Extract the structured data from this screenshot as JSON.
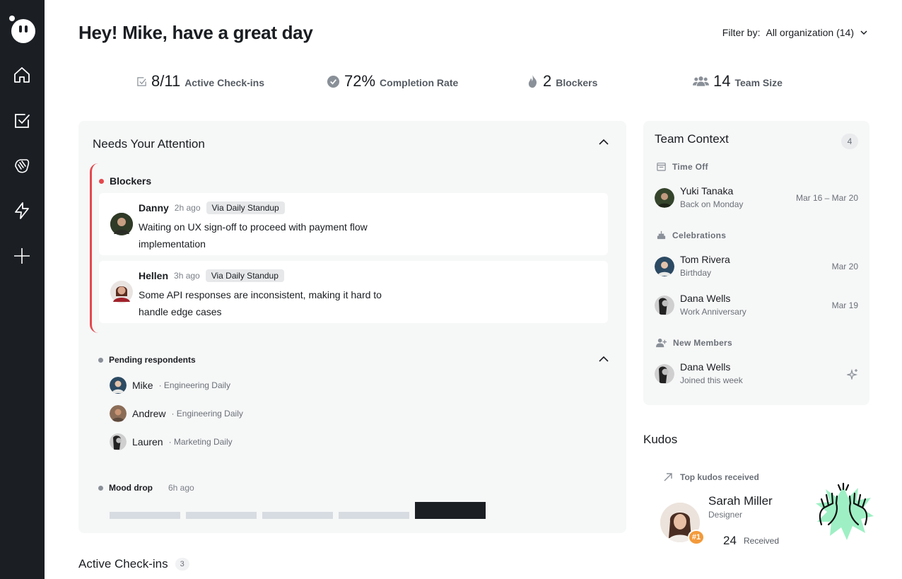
{
  "header": {
    "greeting": "Hey! Mike, have a great day",
    "filter_label": "Filter by:",
    "filter_value": "All organization (14)"
  },
  "stats": [
    {
      "icon": "checkbox-icon",
      "value": "8/11",
      "label": "Active Check-ins"
    },
    {
      "icon": "check-circle-icon",
      "value": "72%",
      "label": "Completion Rate"
    },
    {
      "icon": "flame-icon",
      "value": "2",
      "label": "Blockers"
    },
    {
      "icon": "team-icon",
      "value": "14",
      "label": "Team Size"
    }
  ],
  "attention": {
    "title": "Needs Your Attention",
    "blockers_label": "Blockers",
    "blockers": [
      {
        "name": "Danny",
        "time": "2h ago",
        "via": "Via Daily Standup",
        "message": "Waiting on UX sign-off to proceed with payment flow implementation"
      },
      {
        "name": "Hellen",
        "time": "3h ago",
        "via": "Via Daily Standup",
        "message": "Some API responses are inconsistent, making it hard to handle edge cases"
      }
    ],
    "pending_label": "Pending respondents",
    "pending": [
      {
        "name": "Mike",
        "meta": "· Engineering Daily"
      },
      {
        "name": "Andrew",
        "meta": "· Engineering Daily"
      },
      {
        "name": "Lauren",
        "meta": "· Marketing Daily"
      }
    ],
    "mood_label": "Mood drop",
    "mood_time": "6h ago",
    "mood_values": [
      0.4,
      0.4,
      0.4,
      0.4,
      1.0
    ]
  },
  "active_checkins": {
    "title": "Active Check-ins",
    "count": "3"
  },
  "team_context": {
    "title": "Team Context",
    "count": "4",
    "time_off_label": "Time Off",
    "time_off": [
      {
        "name": "Yuki Tanaka",
        "sub": "Back on Monday",
        "date": "Mar 16 – Mar 20"
      }
    ],
    "celebrations_label": "Celebrations",
    "celebrations": [
      {
        "name": "Tom Rivera",
        "sub": "Birthday",
        "date": "Mar 20"
      },
      {
        "name": "Dana Wells",
        "sub": "Work Anniversary",
        "date": "Mar 19"
      }
    ],
    "new_members_label": "New Members",
    "new_members": [
      {
        "name": "Dana Wells",
        "sub": "Joined this week"
      }
    ]
  },
  "kudos": {
    "title": "Kudos",
    "sub": "Top kudos received",
    "name": "Sarah Miller",
    "role": "Designer",
    "rank": "#1",
    "count": "24",
    "count_label": "Received"
  },
  "colors": {
    "sidebar": "#1b1f24",
    "blocker": "#e5484d",
    "panel": "#f6f7f7",
    "rank": "#f39a3b",
    "kudos_burst": "#9ef0c4"
  }
}
